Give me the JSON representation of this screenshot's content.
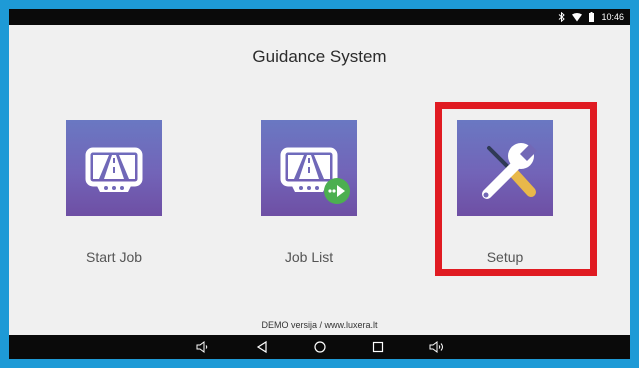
{
  "status_bar": {
    "time": "10:46",
    "icons": [
      "bluetooth-icon",
      "wifi-icon",
      "battery-icon"
    ]
  },
  "app": {
    "title": "Guidance System",
    "tiles": [
      {
        "label": "Start Job",
        "icon": "road-monitor-icon"
      },
      {
        "label": "Job List",
        "icon": "road-monitor-forward-icon"
      },
      {
        "label": "Setup",
        "icon": "wrench-screwdriver-icon"
      }
    ],
    "footer": "DEMO versija / www.luxera.lt"
  },
  "nav_bar": {
    "buttons": [
      "volume-down-icon",
      "back-icon",
      "home-icon",
      "recents-icon",
      "volume-up-icon"
    ]
  },
  "colors": {
    "highlight": "#e01b22",
    "tile_top": "#6a78c2",
    "tile_bottom": "#6e4fa4",
    "frame": "#1e9ad6",
    "badge": "#4caf50"
  }
}
